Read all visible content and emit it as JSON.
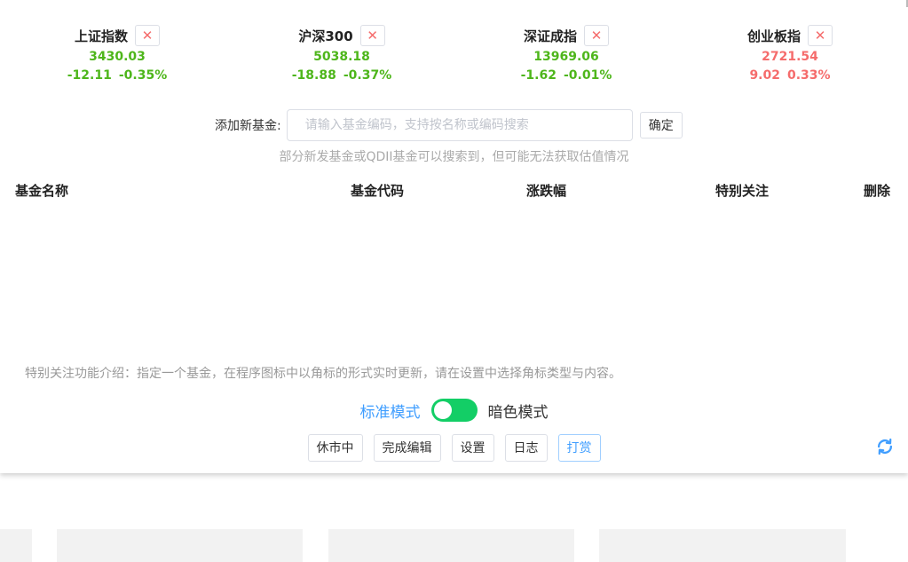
{
  "indices": [
    {
      "name": "上证指数",
      "value": "3430.03",
      "change": "-12.11",
      "percent": "-0.35%",
      "direction": "down"
    },
    {
      "name": "沪深300",
      "value": "5038.18",
      "change": "-18.88",
      "percent": "-0.37%",
      "direction": "down"
    },
    {
      "name": "深证成指",
      "value": "13969.06",
      "change": "-1.62",
      "percent": "-0.01%",
      "direction": "down"
    },
    {
      "name": "创业板指",
      "value": "2721.54",
      "change": "9.02",
      "percent": "0.33%",
      "direction": "up"
    }
  ],
  "remove_icon_glyph": "✕",
  "add_fund": {
    "label": "添加新基金:",
    "placeholder": "请输入基金编码，支持按名称或编码搜索",
    "value": "",
    "confirm_label": "确定",
    "hint": "部分新发基金或QDII基金可以搜索到，但可能无法获取估值情况"
  },
  "table": {
    "headers": [
      "基金名称",
      "基金代码",
      "涨跌幅",
      "特别关注",
      "删除"
    ],
    "rows": []
  },
  "feature_note": "特别关注功能介绍：指定一个基金，在程序图标中以角标的形式实时更新，请在设置中选择角标类型与内容。",
  "mode": {
    "standard_label": "标准模式",
    "dark_label": "暗色模式",
    "toggle_on": true
  },
  "buttons": {
    "market_status": "休市中",
    "finish_edit": "完成编辑",
    "settings": "设置",
    "log": "日志",
    "reward": "打赏"
  },
  "icons": {
    "refresh": "refresh-icon"
  },
  "colors": {
    "up": "#f56c6c",
    "down": "#4eb61b",
    "primary": "#409eff",
    "toggle_on": "#13ce66"
  }
}
